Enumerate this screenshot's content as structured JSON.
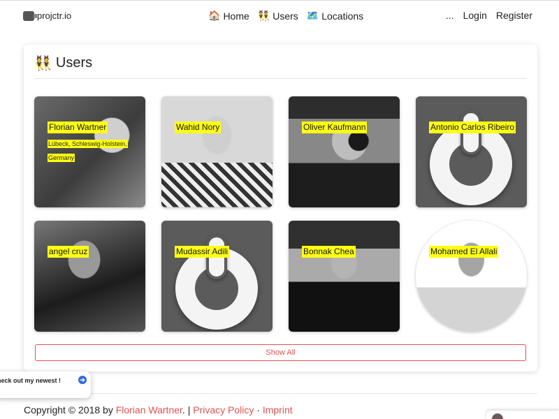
{
  "nav": {
    "brand": "projctr.io",
    "links": [
      {
        "icon": "🏠",
        "label": "Home"
      },
      {
        "icon": "👯",
        "label": "Users"
      },
      {
        "icon": "🗺️",
        "label": "Locations"
      }
    ],
    "more": "...",
    "login": "Login",
    "register": "Register"
  },
  "users_card": {
    "icon": "👯",
    "title": "Users",
    "users": [
      {
        "name": "Florian Wartner",
        "location": "Lübeck, Schleswig-Holstein, Germany"
      },
      {
        "name": "Wahid Nory"
      },
      {
        "name": "Oliver Kaufmann"
      },
      {
        "name": "Antonio Carlos Ribeiro"
      },
      {
        "name": "angel cruz"
      },
      {
        "name": "Mudassir Adili"
      },
      {
        "name": "Bonnak Chea"
      },
      {
        "name": "Mohamed El Allali"
      }
    ],
    "show_all": "Show All"
  },
  "footer": {
    "copyright": "Copyright © 2018 by ",
    "author": "Florian Wartner",
    "separator1": ". | ",
    "privacy": "Privacy Policy",
    "separator2": " · ",
    "imprint": "Imprint"
  },
  "popup": {
    "text": "heck out my newest !",
    "arrow": "➔"
  }
}
